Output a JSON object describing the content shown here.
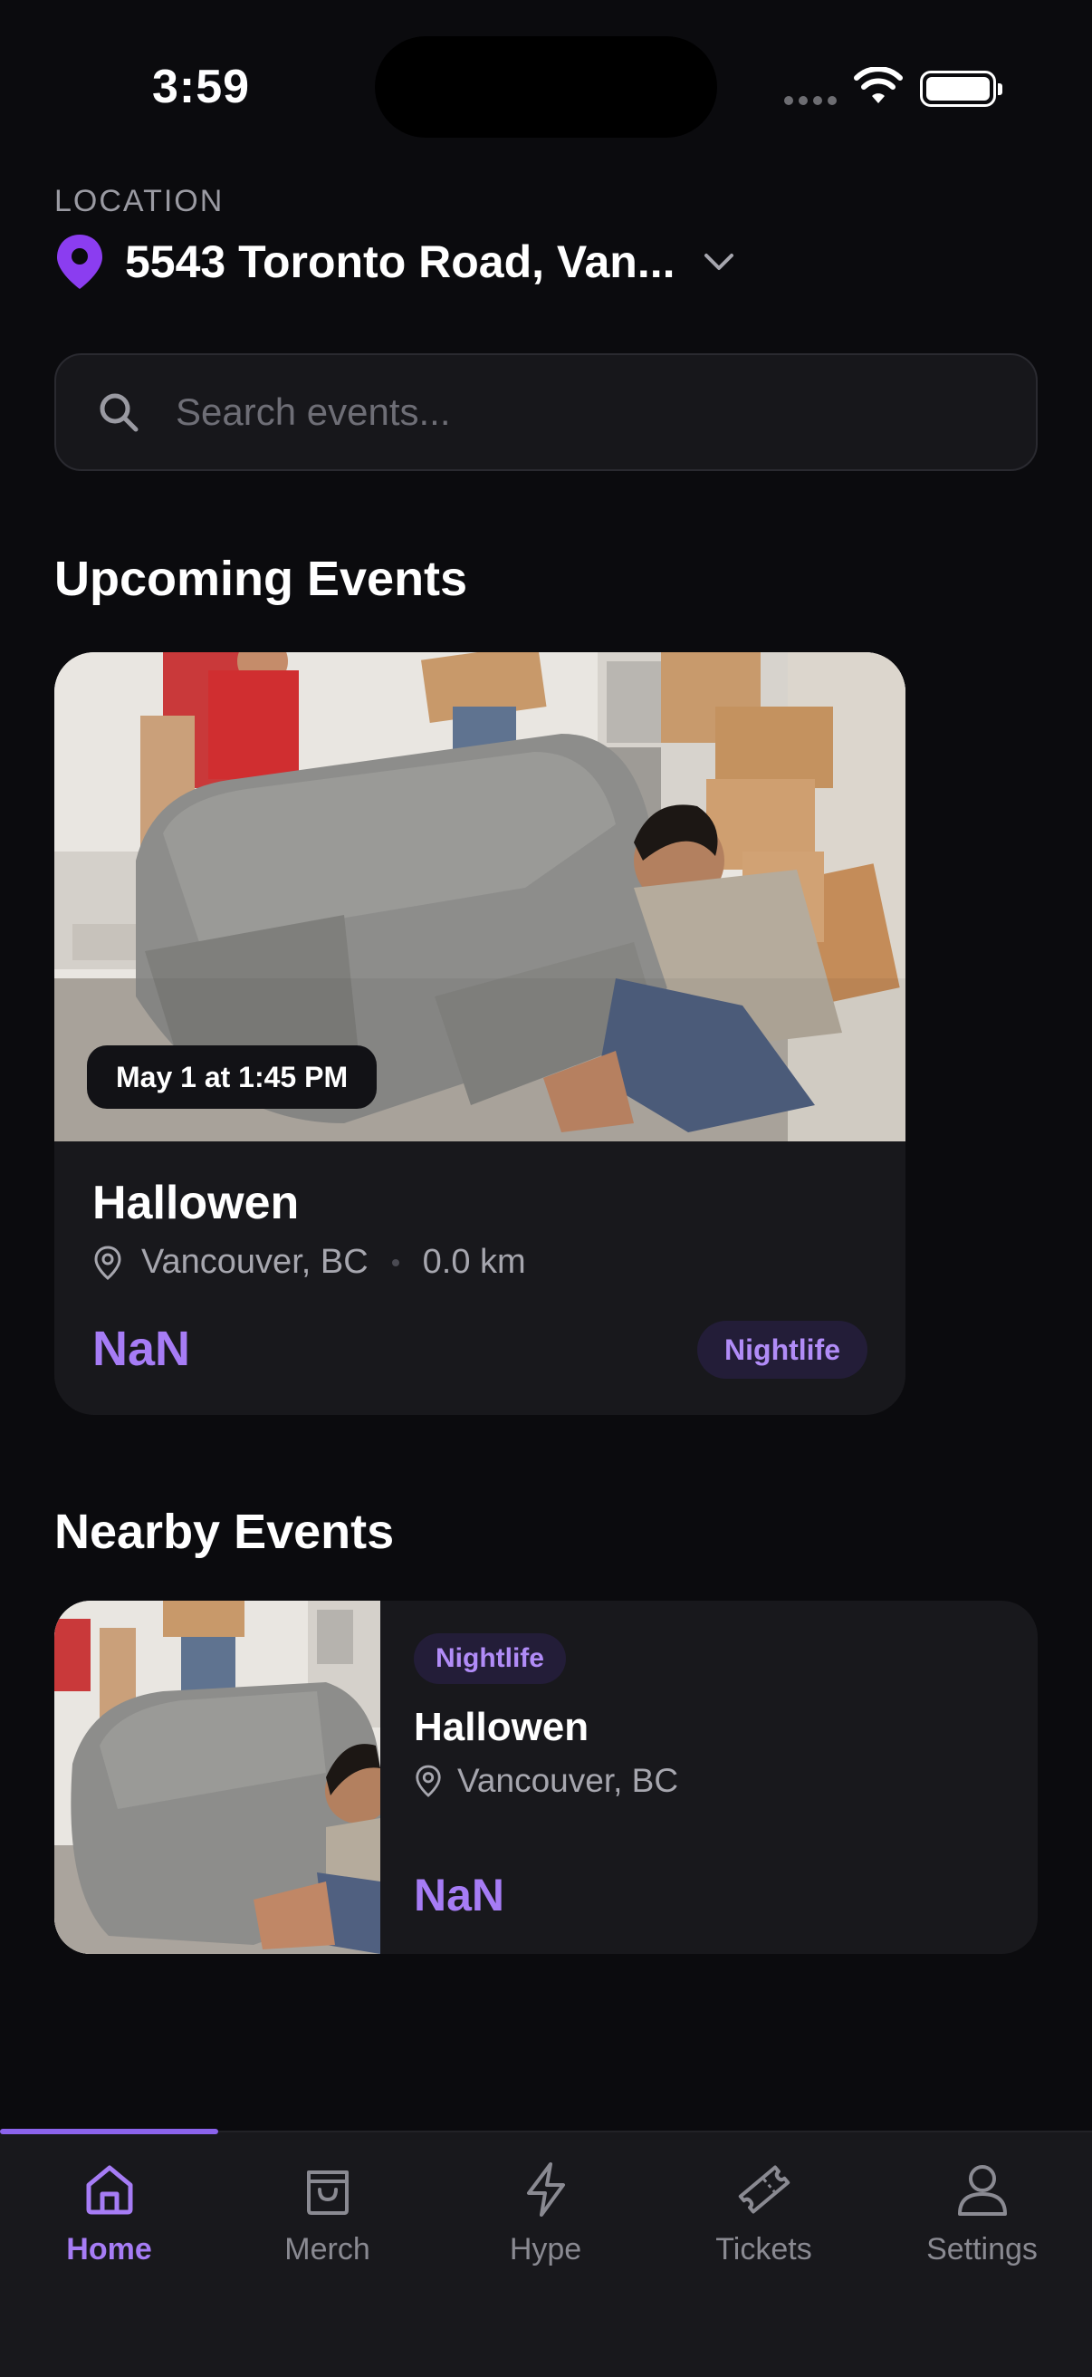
{
  "status_bar": {
    "time": "3:59"
  },
  "location": {
    "label": "LOCATION",
    "address": "5543 Toronto Road, Van..."
  },
  "search": {
    "placeholder": "Search events..."
  },
  "upcoming": {
    "title": "Upcoming Events",
    "card": {
      "date": "May 1 at 1:45 PM",
      "name": "Hallowen",
      "city": "Vancouver, BC",
      "distance": "0.0 km",
      "price": "NaN",
      "category": "Nightlife"
    }
  },
  "nearby": {
    "title": "Nearby Events",
    "card": {
      "category": "Nightlife",
      "name": "Hallowen",
      "city": "Vancouver, BC",
      "price": "NaN"
    }
  },
  "tabs": [
    {
      "label": "Home",
      "icon": "home-icon",
      "active": true
    },
    {
      "label": "Merch",
      "icon": "bag-icon",
      "active": false
    },
    {
      "label": "Hype",
      "icon": "lightning-icon",
      "active": false
    },
    {
      "label": "Tickets",
      "icon": "ticket-icon",
      "active": false
    },
    {
      "label": "Settings",
      "icon": "person-icon",
      "active": false
    }
  ],
  "colors": {
    "accent": "#a67cf5",
    "background": "#0b0b0e",
    "card": "#18181c",
    "pin": "#8b3df0"
  }
}
